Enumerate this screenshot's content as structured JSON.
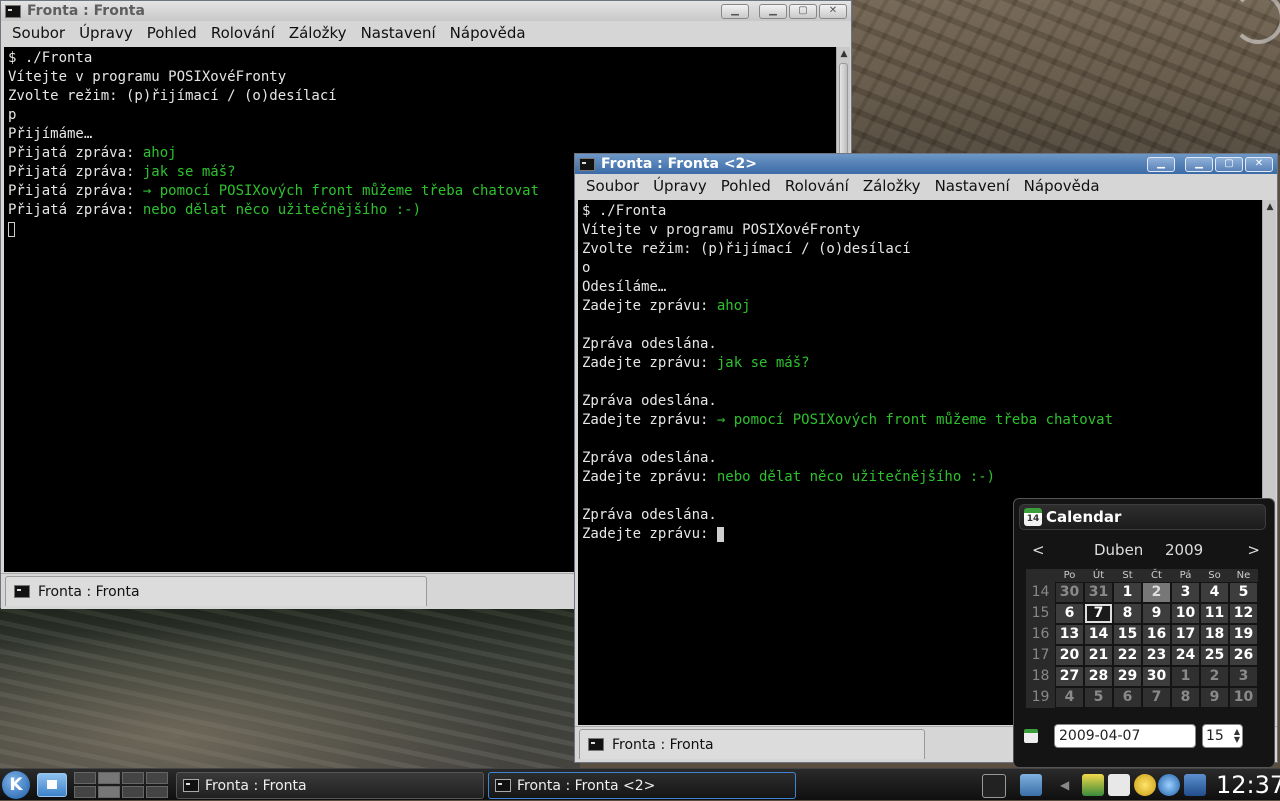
{
  "window1": {
    "title": "Fronta : Fronta",
    "menu": [
      "Soubor",
      "Úpravy",
      "Pohled",
      "Rolování",
      "Záložky",
      "Nastavení",
      "Nápověda"
    ],
    "terminal_lines": [
      {
        "text": "$ ./Fronta"
      },
      {
        "text": "Vítejte v programu POSIXovéFronty"
      },
      {
        "text": "Zvolte režim: (p)řijímací / (o)desílací"
      },
      {
        "text": "p"
      },
      {
        "text": "Přijímáme…"
      },
      {
        "prefix": "Přijatá zpráva: ",
        "text": "ahoj"
      },
      {
        "prefix": "Přijatá zpráva: ",
        "text": "jak se máš?"
      },
      {
        "prefix": "Přijatá zpráva: ",
        "text": "→ pomocí POSIXových front můžeme třeba chatovat"
      },
      {
        "prefix": "Přijatá zpráva: ",
        "text": "nebo dělat něco užitečnějšího :-)"
      }
    ],
    "tab_label": "Fronta : Fronta"
  },
  "window2": {
    "title": "Fronta : Fronta <2>",
    "menu": [
      "Soubor",
      "Úpravy",
      "Pohled",
      "Rolování",
      "Záložky",
      "Nastavení",
      "Nápověda"
    ],
    "terminal_lines": [
      {
        "text": "$ ./Fronta"
      },
      {
        "text": "Vítejte v programu POSIXovéFronty"
      },
      {
        "text": "Zvolte režim: (p)řijímací / (o)desílací"
      },
      {
        "text": "o"
      },
      {
        "text": "Odesíláme…"
      },
      {
        "prefix": "Zadejte zprávu: ",
        "text": "ahoj"
      },
      {
        "text": ""
      },
      {
        "text": "Zpráva odeslána."
      },
      {
        "prefix": "Zadejte zprávu: ",
        "text": "jak se máš?"
      },
      {
        "text": ""
      },
      {
        "text": "Zpráva odeslána."
      },
      {
        "prefix": "Zadejte zprávu: ",
        "text": "→ pomocí POSIXových front můžeme třeba chatovat"
      },
      {
        "text": ""
      },
      {
        "text": "Zpráva odeslána."
      },
      {
        "prefix": "Zadejte zprávu: ",
        "text": "nebo dělat něco užitečnějšího :-)"
      },
      {
        "text": ""
      },
      {
        "text": "Zpráva odeslána."
      },
      {
        "prefix": "Zadejte zprávu: ",
        "text": ""
      }
    ],
    "tab_label": "Fronta : Fronta"
  },
  "calendar": {
    "title": "Calendar",
    "prev": "<",
    "next": ">",
    "month": "Duben",
    "year": "2009",
    "weekdays": [
      "Po",
      "Út",
      "St",
      "Čt",
      "Pá",
      "So",
      "Ne"
    ],
    "weeks": [
      {
        "num": "14",
        "days": [
          "30",
          "31",
          "1",
          "2",
          "3",
          "4",
          "5"
        ]
      },
      {
        "num": "15",
        "days": [
          "6",
          "7",
          "8",
          "9",
          "10",
          "11",
          "12"
        ]
      },
      {
        "num": "16",
        "days": [
          "13",
          "14",
          "15",
          "16",
          "17",
          "18",
          "19"
        ]
      },
      {
        "num": "17",
        "days": [
          "20",
          "21",
          "22",
          "23",
          "24",
          "25",
          "26"
        ]
      },
      {
        "num": "18",
        "days": [
          "27",
          "28",
          "29",
          "30",
          "1",
          "2",
          "3"
        ]
      },
      {
        "num": "19",
        "days": [
          "4",
          "5",
          "6",
          "7",
          "8",
          "9",
          "10"
        ]
      }
    ],
    "date_value": "2009-04-07",
    "week_value": "15"
  },
  "taskbar": {
    "k_label": "K",
    "tasks": [
      "Fronta : Fronta",
      "Fronta : Fronta <2>"
    ],
    "clock": "12:37"
  },
  "colors": {
    "terminal_green": "#2ec12e",
    "active_title": "#3b6aa6",
    "task_active_border": "#3e86d4"
  }
}
